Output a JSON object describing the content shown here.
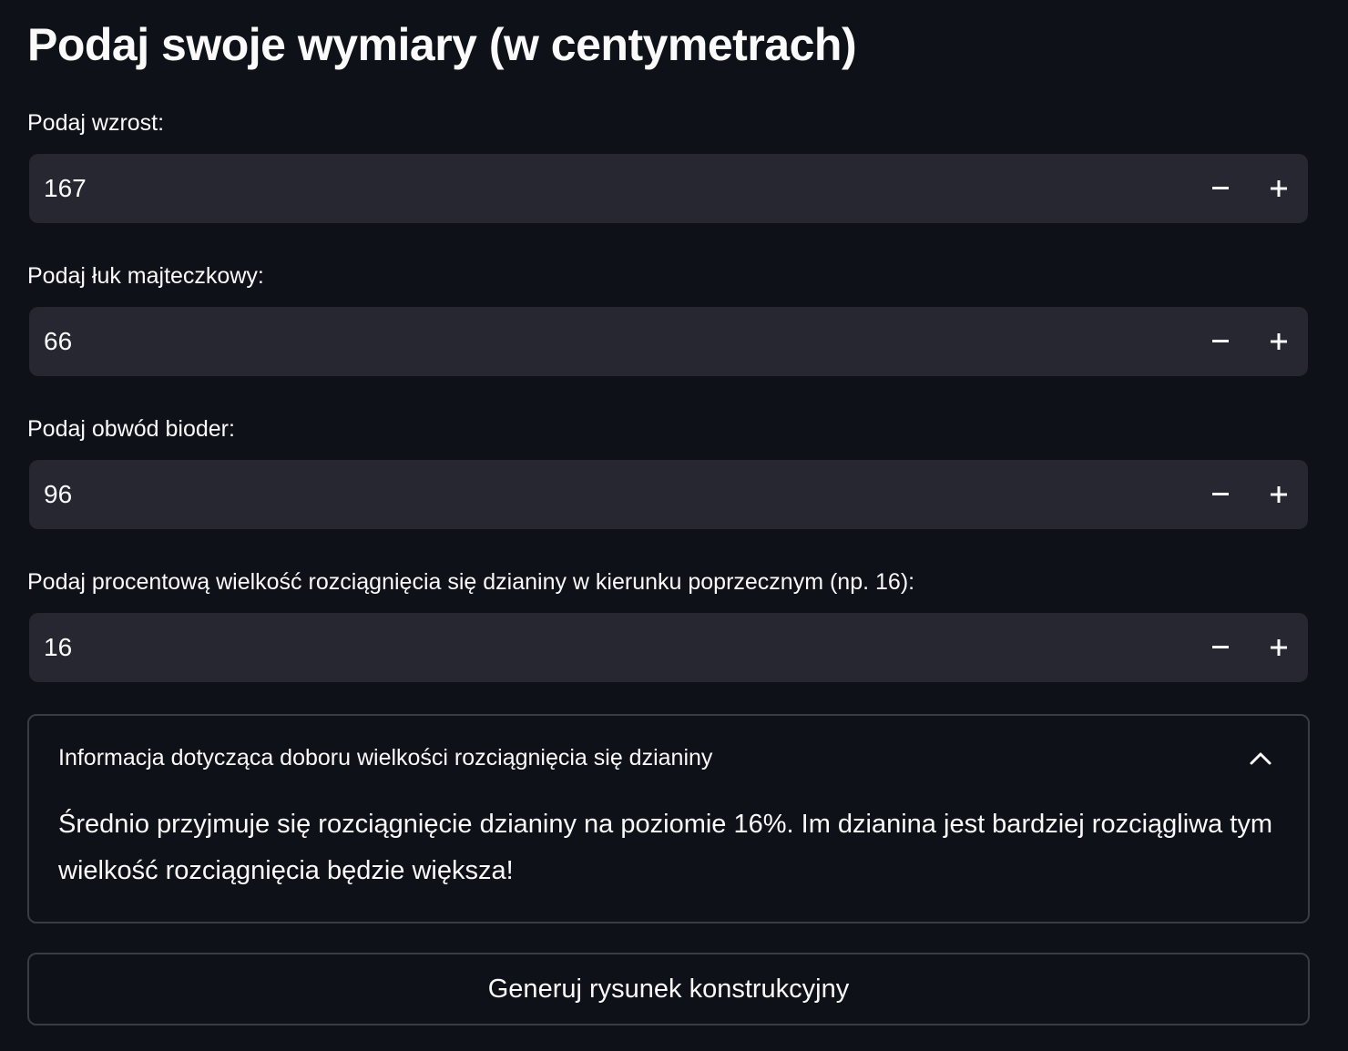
{
  "page": {
    "title": "Podaj swoje wymiary (w centymetrach)"
  },
  "fields": [
    {
      "label": "Podaj wzrost:",
      "value": "167"
    },
    {
      "label": "Podaj łuk majteczkowy:",
      "value": "66"
    },
    {
      "label": "Podaj obwód bioder:",
      "value": "96"
    },
    {
      "label": "Podaj procentową wielkość rozciągnięcia się dzianiny w kierunku poprzecznym (np. 16):",
      "value": "16"
    }
  ],
  "stepper": {
    "minus_icon": "minus-icon",
    "plus_icon": "plus-icon"
  },
  "expander": {
    "title": "Informacja dotycząca doboru wielkości rozciągnięcia się dzianiny",
    "expanded": true,
    "icon": "chevron-up-icon",
    "body": "Średnio przyjmuje się rozciągnięcie dzianiny na poziomie 16%. Im dzianina jest bardziej rozciągliwa tym wielkość rozciągnięcia będzie większa!"
  },
  "action": {
    "button_label": "Generuj rysunek konstrukcyjny"
  },
  "colors": {
    "background": "#0e1117",
    "input_background": "#262730",
    "border": "#3a3c45",
    "text": "#fafafa"
  }
}
